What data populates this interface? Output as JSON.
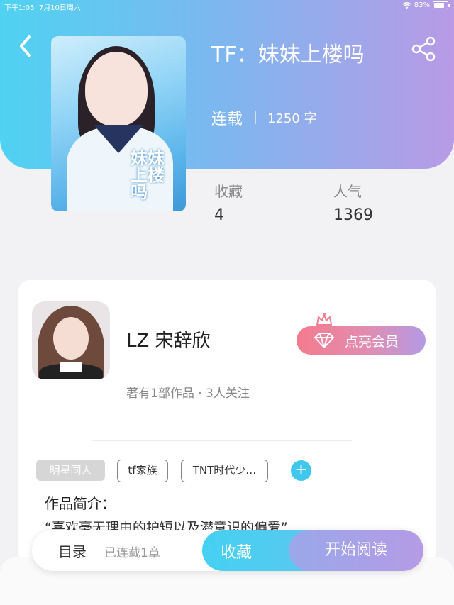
{
  "status_bar": {
    "time": "下午1:05",
    "date": "7月10日周六",
    "battery": "83%",
    "wifi_icon": "wifi-icon"
  },
  "header": {
    "back_icon": "chevron-left-icon",
    "share_icon": "share-icon",
    "title": "TF：妹妹上楼吗"
  },
  "book": {
    "cover_title": "妹妹上楼",
    "cover_subtitle": "吗",
    "status": "连载",
    "word_count": "1250 字"
  },
  "stats": [
    {
      "label": "收藏",
      "value": "4"
    },
    {
      "label": "人气",
      "value": "1369"
    }
  ],
  "author": {
    "name": "LZ 宋辞欣",
    "meta": "著有1部作品 · 3人关注",
    "vip_button": "点亮会员"
  },
  "tags": [
    "明星同人",
    "tf家族",
    "TNT时代少…"
  ],
  "intro": {
    "heading": "作品简介：",
    "text": "“喜欢毫无理由的护短以及潜意识的偏爱”"
  },
  "bottom_bar": {
    "toc_label": "目录",
    "toc_count": "已连载1章",
    "favorite": "收藏",
    "start_reading": "开始阅读"
  },
  "colors": {
    "header_start": "#4fd2f2",
    "header_end": "#b89ae6",
    "accent_blue": "#3fc7ee",
    "vip_pink": "#f57b8f"
  }
}
